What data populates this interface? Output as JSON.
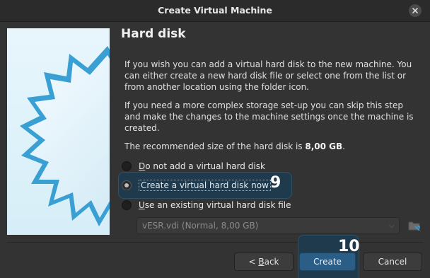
{
  "window": {
    "title": "Create Virtual Machine"
  },
  "page": {
    "heading": "Hard disk",
    "paragraph1": "If you wish you can add a virtual hard disk to the new machine. You can either create a new hard disk file or select one from the list or from another location using the folder icon.",
    "paragraph2": "If you need a more complex storage set-up you can skip this step and make the changes to the machine settings once the machine is created.",
    "recommended_prefix": "The recommended size of the hard disk is ",
    "recommended_size": "8,00 GB",
    "recommended_suffix": "."
  },
  "options": {
    "opt1_u": "D",
    "opt1_rest": "o not add a virtual hard disk",
    "opt2": "Create a virtual hard disk now",
    "opt2_selected": true,
    "opt3_u": "U",
    "opt3_rest": "se an existing virtual hard disk file"
  },
  "disk_select": {
    "value": "vESR.vdi (Normal, 8,00 GB)",
    "enabled": false
  },
  "buttons": {
    "back_prefix": "< ",
    "back_u": "B",
    "back_rest": "ack",
    "create": "Create",
    "cancel": "Cancel"
  },
  "annotations": {
    "step_a": "9",
    "step_b": "10"
  },
  "colors": {
    "accent": "#2b5e86",
    "highlight": "#1f3a4d",
    "background": "#333333"
  }
}
